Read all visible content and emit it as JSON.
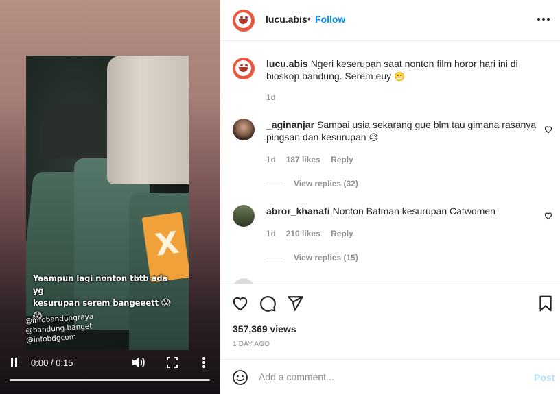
{
  "video": {
    "caption_line1": "Yaampun lagi nonton tbtb ada yg",
    "caption_line2": "kesurupan serem bangeeett",
    "caption_emoji": "😱 😱",
    "credits": [
      "@infobandungraya",
      "@bandung.banget",
      "@infobdgcom"
    ],
    "time": "0:00 / 0:15",
    "progress_fraction": 0
  },
  "header": {
    "username": "lucu.abis",
    "separator": "•",
    "follow_label": "Follow"
  },
  "caption": {
    "username": "lucu.abis",
    "text": "Ngeri keserupan saat nonton film horor hari ini di bioskop bandung. Serem euy",
    "emoji": "😬",
    "time": "1d"
  },
  "comments": [
    {
      "username": "_aginanjar",
      "text": "Sampai usia sekarang gue blm tau gimana rasanya pingsan dan kesurupan",
      "emoji": "😥",
      "time": "1d",
      "likes": "187 likes",
      "reply_label": "Reply",
      "view_replies": "View replies (32)"
    },
    {
      "username": "abror_khanafi",
      "text": "Nonton Batman kesurupan Catwomen",
      "emoji": "",
      "time": "1d",
      "likes": "210 likes",
      "reply_label": "Reply",
      "view_replies": "View replies (15)"
    }
  ],
  "stats": {
    "views": "357,369 views",
    "date": "1 DAY AGO"
  },
  "add_comment": {
    "placeholder": "Add a comment...",
    "post_label": "Post"
  },
  "colors": {
    "accent": "#0095f6",
    "post_disabled": "#b2dffc",
    "muted": "#8e8e8e",
    "brand_avatar": "#e9573f"
  },
  "icons": [
    "play-pause-icon",
    "volume-icon",
    "fullscreen-icon",
    "more-vertical-icon",
    "more-horizontal-icon",
    "heart-icon",
    "comment-icon",
    "share-icon",
    "bookmark-icon",
    "emoji-icon"
  ]
}
